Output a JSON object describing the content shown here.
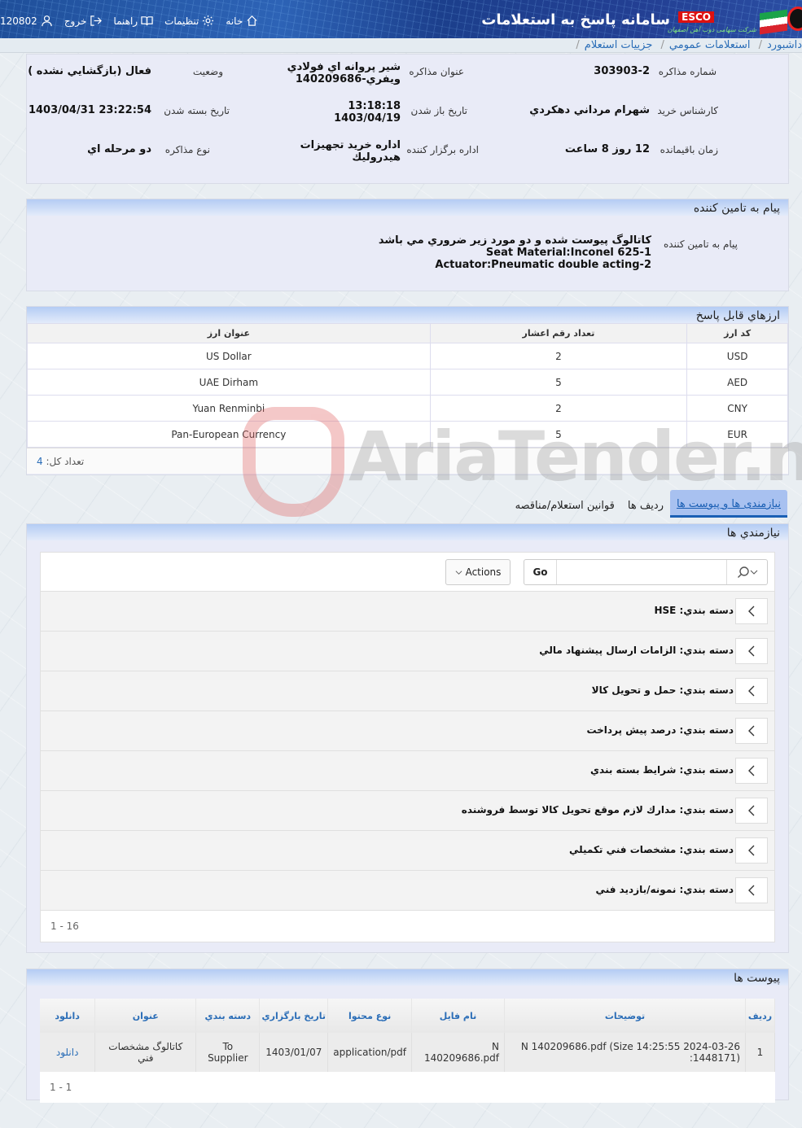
{
  "header": {
    "title": "سامانه پاسخ به استعلامات",
    "brand": "ESCO",
    "brand_sub": "شرکت سهامی ذوب آهن اصفهان",
    "nav": {
      "home": "خانه",
      "settings": "تنظيمات",
      "help": "راهنما",
      "logout": "خروج",
      "user_id": "120802"
    }
  },
  "breadcrumb": [
    "داشبورد",
    "استعلامات عمومي",
    "جزييات استعلام"
  ],
  "details": {
    "negotiation_number_label": "شماره مذاکره",
    "negotiation_number": "303903-2",
    "title_label": "عنوان مذاکره",
    "title_value": "شير پروانه اي فولادي ويفري-140209686",
    "status_label": "وضعيت",
    "status_value": "فعال (بازگشايي نشده )",
    "buyer_label": "کارشناس خريد",
    "buyer_value": "شهرام مرداني دهکردي",
    "open_date_label": "تاريخ باز شدن",
    "open_time": "13:18:18",
    "open_date": "1403/04/19",
    "close_date_label": "تاريخ بسته شدن",
    "close_date_value": "1403/04/31 23:22:54",
    "remaining_label": "زمان باقيمانده",
    "remaining_value": "12 روز 8 ساعت",
    "organizer_label": "اداره برگزار کننده",
    "organizer_value": "اداره خريد تجهيزات هيدروليك",
    "type_label": "نوع مذاکره",
    "type_value": "دو مرحله اي"
  },
  "supplier_message": {
    "heading": "پيام به تامين کننده",
    "label": "پيام به تامين کننده",
    "lines": [
      "کاتالوگ پيوست شده و دو مورد زير ضروري مي باشد",
      "Seat Material:Inconel 625-1",
      "Actuator:Pneumatic double acting-2"
    ]
  },
  "currencies": {
    "heading": "ارزهاي قابل پاسخ",
    "columns": [
      "کد ارز",
      "تعداد رقم اعشار",
      "عنوان ارز"
    ],
    "rows": [
      {
        "code": "USD",
        "decimals": "2",
        "name": "US Dollar"
      },
      {
        "code": "AED",
        "decimals": "5",
        "name": "UAE Dirham"
      },
      {
        "code": "CNY",
        "decimals": "2",
        "name": "Yuan Renminbi"
      },
      {
        "code": "EUR",
        "decimals": "5",
        "name": "Pan-European Currency"
      }
    ],
    "total_label": "تعداد کل:",
    "total": "4"
  },
  "tabs": [
    {
      "label": "نيازمندی ها و پيوست ها",
      "active": true
    },
    {
      "label": "رديف ها",
      "active": false
    },
    {
      "label": "قوانين استعلام/مناقصه",
      "active": false
    }
  ],
  "requirements": {
    "heading": "نيازمندي ها",
    "search_placeholder": "",
    "go_label": "Go",
    "actions_label": "Actions",
    "items": [
      "دسته بندي: HSE",
      "دسته بندي: الزامات ارسال پيشنهاد مالي",
      "دسته بندي: حمل و تحويل کالا",
      "دسته بندي: درصد پيش پرداخت",
      "دسته بندي: شرايط بسته بندي",
      "دسته بندي: مدارك لازم موقع تحويل کالا توسط فروشنده",
      "دسته بندي: مشخصات فني تکميلي",
      "دسته بندي: نمونه/بازديد فني"
    ],
    "pagination": "1 - 16"
  },
  "attachments": {
    "heading": "پيوست ها",
    "columns": [
      "رديف",
      "توضيحات",
      "نام فايل",
      "نوع محتوا",
      "تاريخ بارگزاري",
      "دسته بندي",
      "عنوان",
      "دانلود"
    ],
    "rows": [
      {
        "row": "1",
        "description": "N 140209686.pdf (Size 14:25:55 2024-03-26 :1448171)",
        "file_name": "N 140209686.pdf",
        "content_type": "application/pdf",
        "upload_date": "1403/01/07",
        "category": "To Supplier",
        "title": "كاتالوگ مشخصات فني",
        "download": "دانلود"
      }
    ],
    "pagination": "1 - 1"
  },
  "watermark": "AriaTender.neT"
}
